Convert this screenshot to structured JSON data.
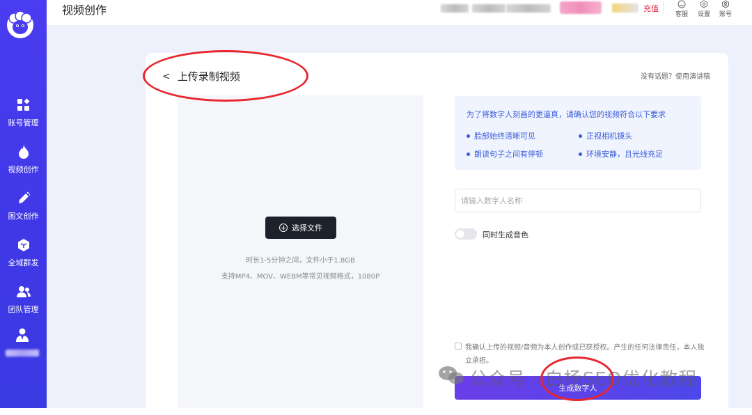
{
  "header": {
    "page_title": "视频创作",
    "recharge": "充值",
    "tools": [
      {
        "label": "客服",
        "icon": "smile-icon"
      },
      {
        "label": "设置",
        "icon": "gear-icon"
      },
      {
        "label": "账号",
        "icon": "user-icon"
      }
    ]
  },
  "sidebar": {
    "items": [
      {
        "label": "账号管理",
        "icon": "grid-icon"
      },
      {
        "label": "视频创作",
        "icon": "fire-icon"
      },
      {
        "label": "图文创作",
        "icon": "pen-icon"
      },
      {
        "label": "全域群发",
        "icon": "cube-icon"
      },
      {
        "label": "团队管理",
        "icon": "team-icon"
      }
    ]
  },
  "card": {
    "back_arrow": "<",
    "title": "上传录制视频",
    "top_link": "没有话题？使用演讲稿"
  },
  "upload": {
    "button_label": "选择文件",
    "hint_duration": "时长1-5分钟之间，文件小于1.8GB",
    "hint_formats": "支持MP4、MOV、WEBM等常见视频格式，1080P"
  },
  "requirements": {
    "title": "为了将数字人刻画的更逼真，请确认您的视频符合以下要求",
    "items": [
      "脸部始终清晰可见",
      "正视相机镜头",
      "朗读句子之间有停顿",
      "环境安静，且光线充足"
    ]
  },
  "form": {
    "name_placeholder": "请输入数字人名称",
    "name_value": "",
    "voice_toggle_label": "同时生成音色",
    "voice_toggle_on": false,
    "consent_text": "我确认上传的视频/音频为本人创作或已获授权。产生的任何法律责任，本人独立承担。",
    "consent_checked": false,
    "generate_button": "生成数字人"
  },
  "watermark": {
    "text": "公众号 · 白杨SEO优化教程"
  },
  "colors": {
    "sidebar": "#4a3cf0",
    "accent_blue": "#3a5bd9",
    "button_dark": "#1d2129",
    "recharge_red": "#e0223a",
    "annotation_red": "#e8262d"
  }
}
